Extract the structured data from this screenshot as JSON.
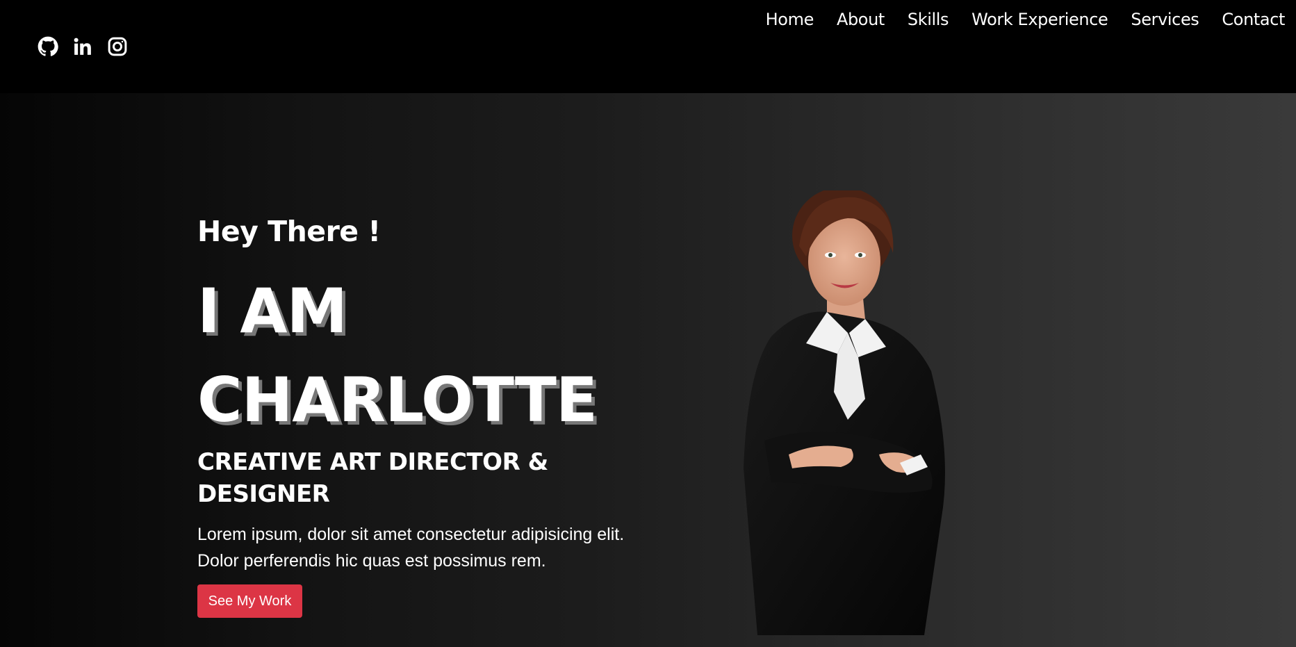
{
  "social": [
    {
      "name": "github",
      "icon": "github-icon"
    },
    {
      "name": "linkedin",
      "icon": "linkedin-icon"
    },
    {
      "name": "instagram",
      "icon": "instagram-icon"
    }
  ],
  "nav": {
    "items": [
      "Home",
      "About",
      "Skills",
      "Work Experience",
      "Services",
      "Contact"
    ]
  },
  "hero": {
    "greeting": "Hey There !",
    "title_line1": "I AM",
    "title_line2": "CHARLOTTE",
    "subtitle_line1": "CREATIVE ART DIRECTOR &",
    "subtitle_line2": "DESIGNER",
    "description_line1": "Lorem ipsum, dolor sit amet consectetur adipisicing elit.",
    "description_line2": "Dolor perferendis hic quas est possimus rem.",
    "cta_label": "See My Work",
    "portrait": "woman-in-black-suit-portrait"
  },
  "colors": {
    "accent": "#dc3545",
    "background": "#000000",
    "text": "#ffffff"
  }
}
